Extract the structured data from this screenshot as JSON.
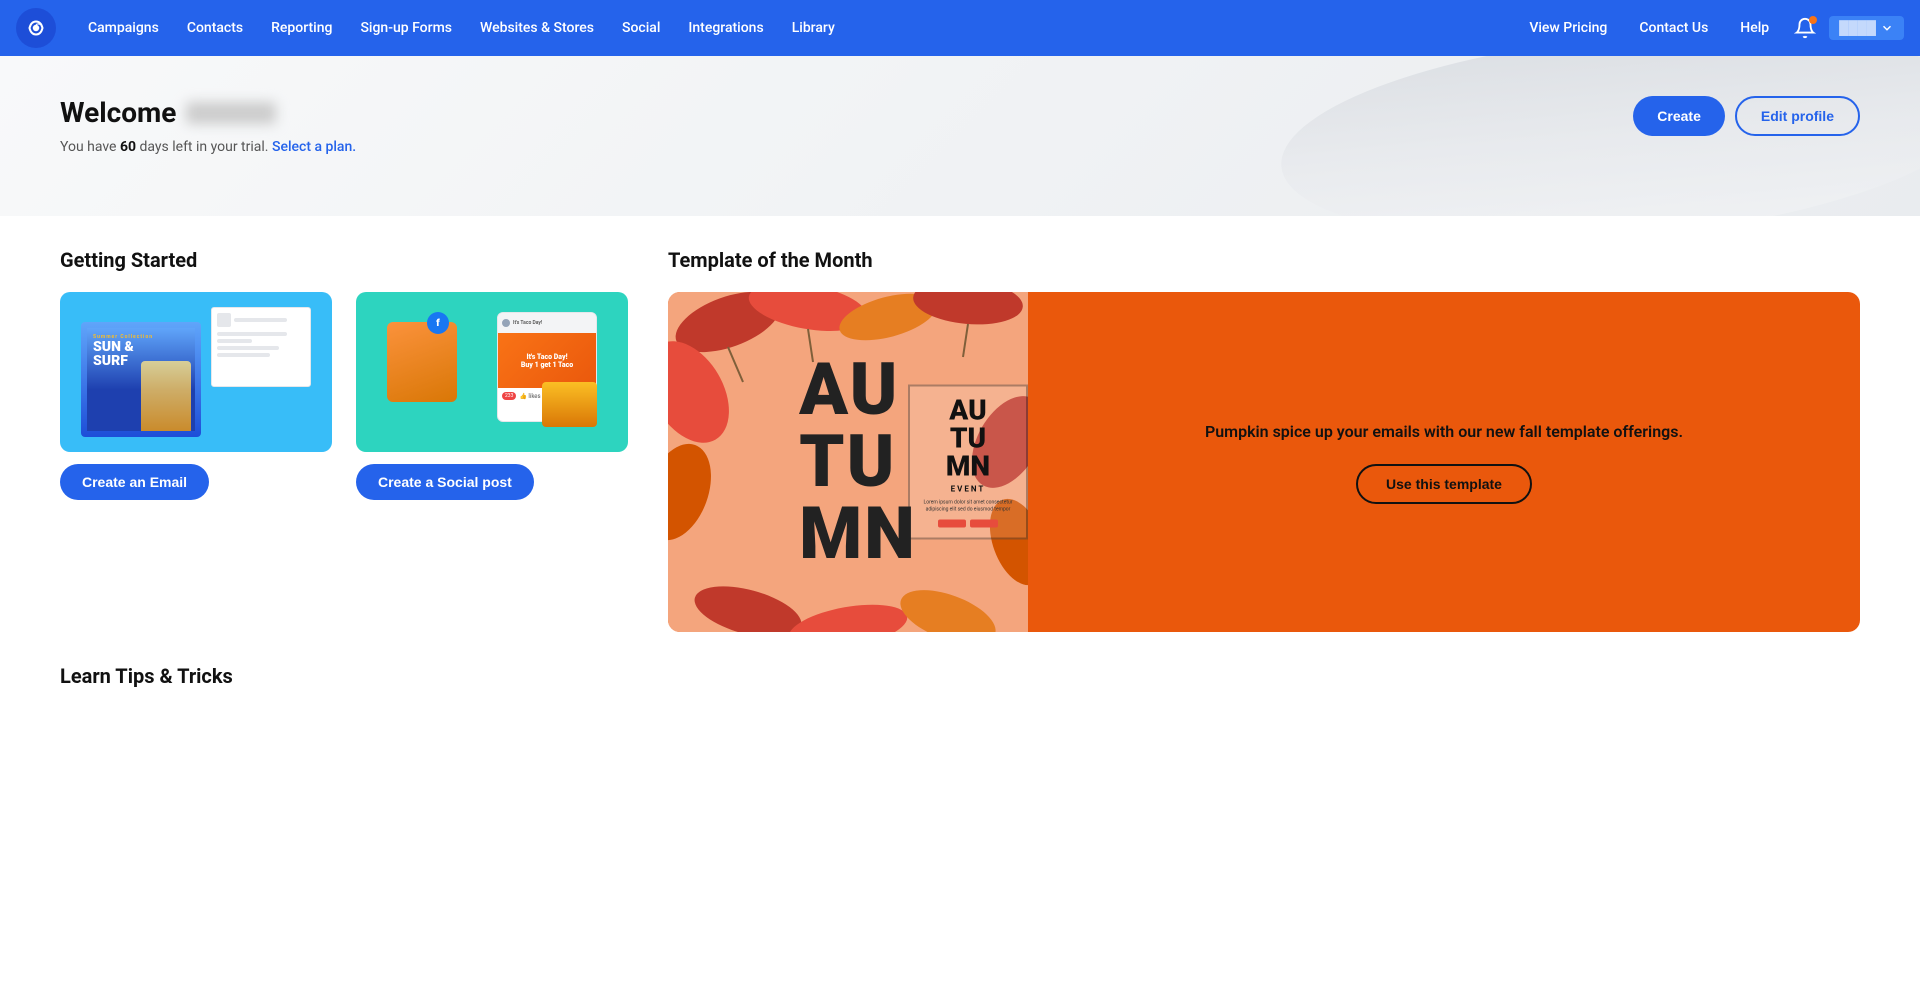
{
  "navbar": {
    "logo_alt": "Constant Contact logo",
    "links": [
      {
        "label": "Campaigns",
        "id": "campaigns"
      },
      {
        "label": "Contacts",
        "id": "contacts"
      },
      {
        "label": "Reporting",
        "id": "reporting"
      },
      {
        "label": "Sign-up Forms",
        "id": "signup-forms"
      },
      {
        "label": "Websites & Stores",
        "id": "websites"
      },
      {
        "label": "Social",
        "id": "social"
      },
      {
        "label": "Integrations",
        "id": "integrations"
      },
      {
        "label": "Library",
        "id": "library"
      }
    ],
    "right_links": [
      {
        "label": "View Pricing",
        "id": "view-pricing"
      },
      {
        "label": "Contact Us",
        "id": "contact-us"
      },
      {
        "label": "Help",
        "id": "help"
      }
    ],
    "avatar_label": "User"
  },
  "hero": {
    "welcome_label": "Welcome",
    "trial_text_prefix": "You have ",
    "trial_days": "60",
    "trial_text_suffix": " days left in your trial.",
    "select_plan_label": "Select a plan.",
    "create_button": "Create",
    "edit_profile_button": "Edit profile"
  },
  "getting_started": {
    "section_title": "Getting Started",
    "cards": [
      {
        "id": "email",
        "button_label": "Create an Email"
      },
      {
        "id": "social",
        "button_label": "Create a Social post"
      }
    ]
  },
  "template_of_month": {
    "section_title": "Template of the Month",
    "autumn_text": [
      "AU",
      "TU",
      "MN"
    ],
    "event_label": "EVENT",
    "description": "Pumpkin spice up your emails with our new fall template offerings.",
    "cta_button": "Use this template"
  },
  "learn_tips": {
    "section_title": "Learn Tips & Tricks"
  }
}
